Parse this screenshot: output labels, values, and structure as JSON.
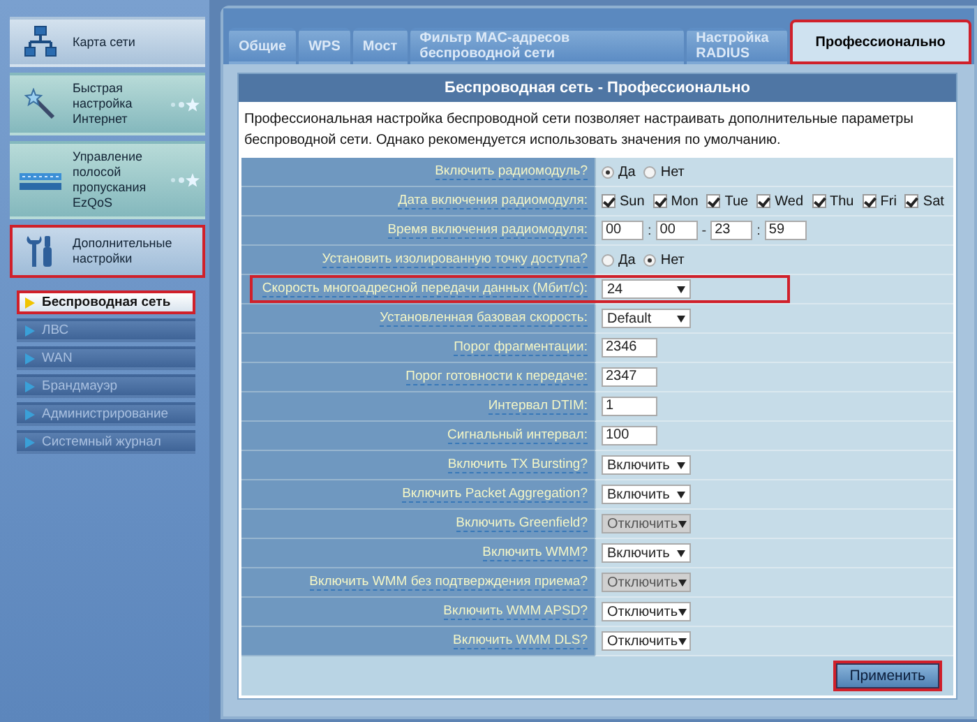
{
  "sidebar": {
    "items": [
      {
        "label": "Карта сети",
        "selected": false,
        "highlighted": false
      },
      {
        "label": "Быстрая настройка Интернет",
        "selected": false,
        "highlighted": false,
        "sparkle": true
      },
      {
        "label": "Управление полосой пропускания EzQoS",
        "selected": false,
        "highlighted": false,
        "sparkle": true
      },
      {
        "label": "Дополнительные настройки",
        "selected": true,
        "highlighted": true
      }
    ],
    "subitems": [
      {
        "label": "Беспроводная сеть",
        "selected": true,
        "highlighted": true
      },
      {
        "label": "ЛВС",
        "selected": false,
        "highlighted": false
      },
      {
        "label": "WAN",
        "selected": false,
        "highlighted": false
      },
      {
        "label": "Брандмауэр",
        "selected": false,
        "highlighted": false
      },
      {
        "label": "Администрирование",
        "selected": false,
        "highlighted": false
      },
      {
        "label": "Системный журнал",
        "selected": false,
        "highlighted": false
      }
    ]
  },
  "tabs": [
    {
      "label": "Общие",
      "selected": false,
      "highlighted": false
    },
    {
      "label": "WPS",
      "selected": false,
      "highlighted": false
    },
    {
      "label": "Мост",
      "selected": false,
      "highlighted": false
    },
    {
      "label": "Фильтр MAC-адресов беспроводной сети",
      "selected": false,
      "highlighted": false
    },
    {
      "label": "Настройка RADIUS",
      "selected": false,
      "highlighted": false
    },
    {
      "label": "Профессионально",
      "selected": true,
      "highlighted": true
    }
  ],
  "panel": {
    "title": "Беспроводная сеть - Профессионально",
    "description": "Профессиональная настройка беспроводной сети позволяет настраивать дополнительные параметры беспроводной сети. Однако рекомендуется использовать значения по умолчанию."
  },
  "settings": [
    {
      "kind": "radio",
      "label": "Включить радиомодуль?",
      "options": [
        {
          "label": "Да",
          "selected": true
        },
        {
          "label": "Нет",
          "selected": false
        }
      ]
    },
    {
      "kind": "checkboxes",
      "label": "Дата включения радиомодуля:",
      "options": [
        {
          "label": "Sun",
          "checked": true
        },
        {
          "label": "Mon",
          "checked": true
        },
        {
          "label": "Tue",
          "checked": true
        },
        {
          "label": "Wed",
          "checked": true
        },
        {
          "label": "Thu",
          "checked": true
        },
        {
          "label": "Fri",
          "checked": true
        },
        {
          "label": "Sat",
          "checked": true
        }
      ]
    },
    {
      "kind": "time",
      "label": "Время включения радиомодуля:",
      "fields": [
        "00",
        "00",
        "23",
        "59"
      ],
      "separators": [
        ":",
        "-",
        ":"
      ]
    },
    {
      "kind": "radio",
      "label": "Установить изолированную точку доступа?",
      "options": [
        {
          "label": "Да",
          "selected": false
        },
        {
          "label": "Нет",
          "selected": true
        }
      ]
    },
    {
      "kind": "select",
      "label": "Скорость многоадресной передачи данных (Мбит/с):",
      "value": "24",
      "disabled": false,
      "highlighted": true
    },
    {
      "kind": "select",
      "label": "Установленная базовая скорость:",
      "value": "Default",
      "disabled": false
    },
    {
      "kind": "text",
      "label": "Порог фрагментации:",
      "value": "2346"
    },
    {
      "kind": "text",
      "label": "Порог готовности к передаче:",
      "value": "2347"
    },
    {
      "kind": "text",
      "label": "Интервал DTIM:",
      "value": "1"
    },
    {
      "kind": "text",
      "label": "Сигнальный интервал:",
      "value": "100"
    },
    {
      "kind": "select",
      "label": "Включить TX Bursting?",
      "value": "Включить",
      "disabled": false
    },
    {
      "kind": "select",
      "label": "Включить Packet Aggregation?",
      "value": "Включить",
      "disabled": false
    },
    {
      "kind": "select",
      "label": "Включить Greenfield?",
      "value": "Отключить",
      "disabled": true
    },
    {
      "kind": "select",
      "label": "Включить WMM?",
      "value": "Включить",
      "disabled": false
    },
    {
      "kind": "select",
      "label": "Включить WMM без подтверждения приема?",
      "value": "Отключить",
      "disabled": true
    },
    {
      "kind": "select",
      "label": "Включить WMM APSD?",
      "value": "Отключить",
      "disabled": false
    },
    {
      "kind": "select",
      "label": "Включить WMM DLS?",
      "value": "Отключить",
      "disabled": false
    }
  ],
  "apply_button": {
    "label": "Применить",
    "highlighted": true
  }
}
